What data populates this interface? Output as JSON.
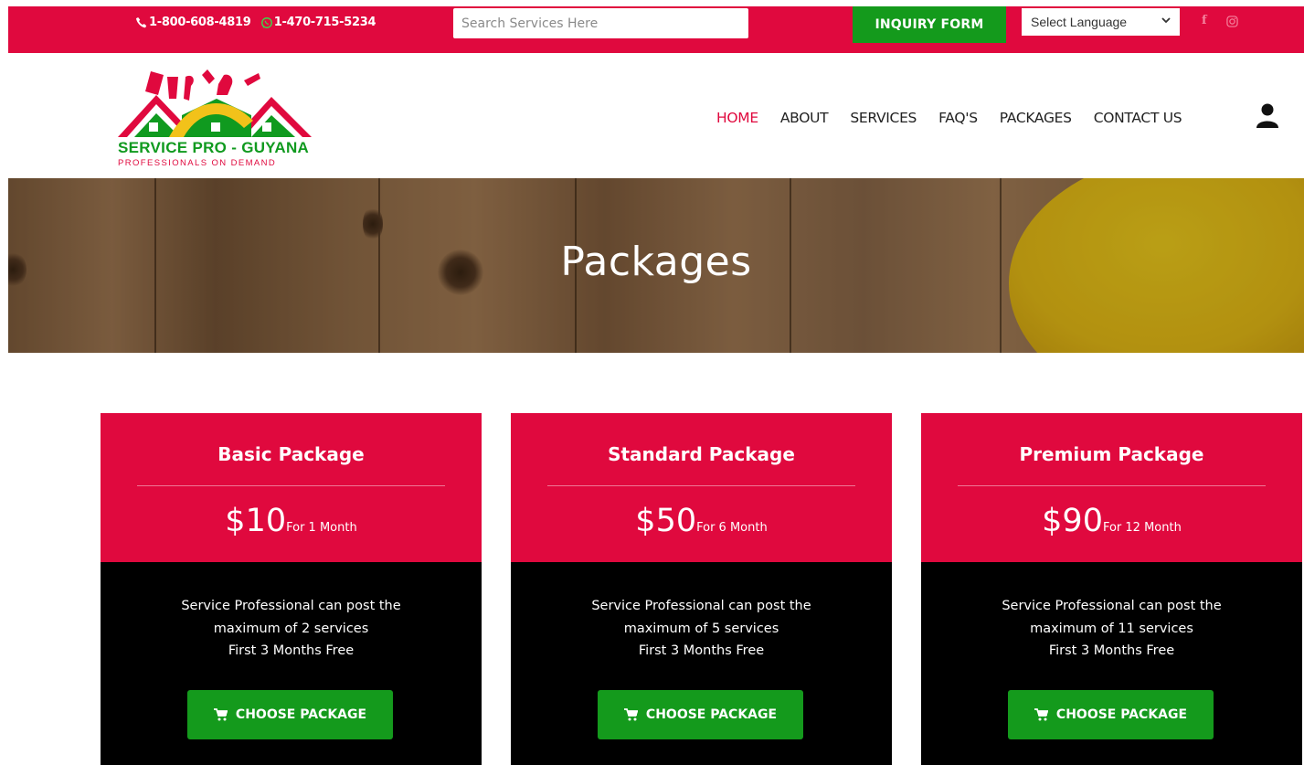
{
  "topbar": {
    "phone": "1-800-608-4819",
    "whatsapp": "1-470-715-5234",
    "search_placeholder": "Search Services Here",
    "inquiry_label": "INQUIRY FORM",
    "language_selected": "Select Language"
  },
  "brand": {
    "name": "SERVICE PRO - GUYANA",
    "tagline": "PROFESSIONALS ON DEMAND"
  },
  "nav": {
    "items": [
      {
        "label": "HOME",
        "active": true
      },
      {
        "label": "ABOUT",
        "active": false
      },
      {
        "label": "SERVICES",
        "active": false
      },
      {
        "label": "FAQ'S",
        "active": false
      },
      {
        "label": "PACKAGES",
        "active": false
      },
      {
        "label": "CONTACT US",
        "active": false
      }
    ]
  },
  "banner": {
    "title": "Packages"
  },
  "packages": [
    {
      "title": "Basic Package",
      "price": "$10",
      "period": "For 1 Month",
      "line1": "Service Professional can post the",
      "line2": "maximum of 2 services",
      "line3": "First 3 Months Free",
      "button": "CHOOSE PACKAGE"
    },
    {
      "title": "Standard Package",
      "price": "$50",
      "period": "For 6 Month",
      "line1": "Service Professional can post the",
      "line2": "maximum of 5 services",
      "line3": "First 3 Months Free",
      "button": "CHOOSE PACKAGE"
    },
    {
      "title": "Premium Package",
      "price": "$90",
      "period": "For 12 Month",
      "line1": "Service Professional can post the",
      "line2": "maximum of 11 services",
      "line3": "First 3 Months Free",
      "button": "CHOOSE PACKAGE"
    }
  ],
  "colors": {
    "brand_red": "#e0093e",
    "action_green": "#149a1c",
    "card_body": "#000000"
  },
  "icons": {
    "phone": "phone-icon",
    "whatsapp": "whatsapp-icon",
    "facebook": "facebook-icon",
    "instagram": "instagram-icon",
    "user": "user-icon",
    "cart": "cart-icon",
    "select": "chevron-down-icon"
  }
}
